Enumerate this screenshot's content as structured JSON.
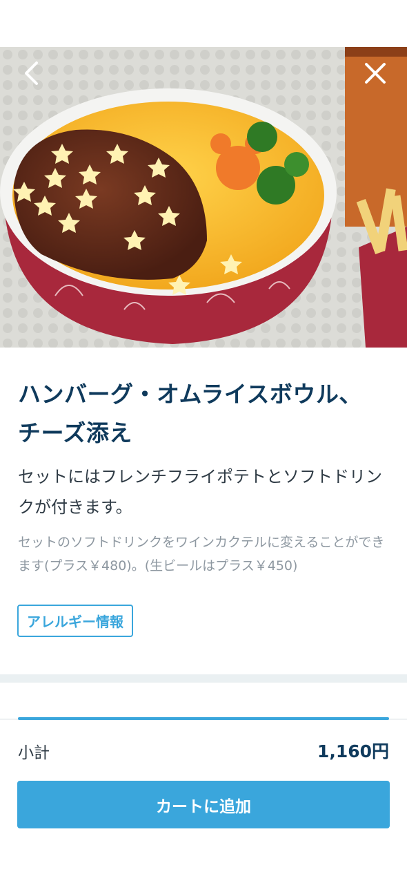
{
  "product": {
    "title_line1": "ハンバーグ・オムライスボウル、",
    "title_line2": "チーズ添え",
    "description": "セットにはフレンチフライポテトとソフトドリンクが付きます。",
    "note": "セットのソフトドリンクをワインカクテルに変えることができます(プラス￥480)。(生ビールはプラス￥450)",
    "allergy_label": "アレルギー情報"
  },
  "navigation": {
    "back_icon": "chevron-left-icon",
    "close_icon": "close-icon"
  },
  "footer": {
    "subtotal_label": "小計",
    "subtotal_value": "1,160円",
    "add_to_cart_label": "カートに追加"
  },
  "colors": {
    "accent": "#3aa6dc",
    "title": "#0f3a5c",
    "text": "#2f3b45",
    "muted": "#8e98a1"
  }
}
